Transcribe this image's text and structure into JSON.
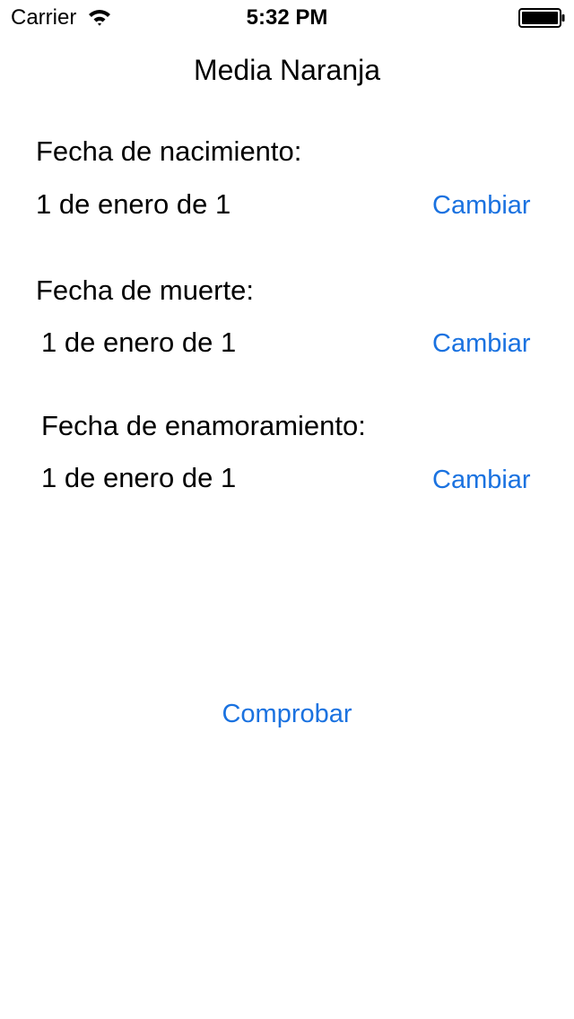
{
  "status_bar": {
    "carrier": "Carrier",
    "time": "5:32 PM",
    "wifi_icon": "wifi-icon",
    "battery_icon": "battery-full-icon"
  },
  "nav": {
    "title": "Media Naranja"
  },
  "sections": [
    {
      "label": "Fecha de nacimiento:",
      "value": "1 de enero de 1",
      "button": "Cambiar"
    },
    {
      "label": "Fecha de muerte:",
      "value": "1 de enero de 1",
      "button": "Cambiar"
    },
    {
      "label": "Fecha de enamoramiento:",
      "value": "1 de enero de 1",
      "button": "Cambiar"
    }
  ],
  "actions": {
    "check_label": "Comprobar"
  },
  "colors": {
    "accent": "#1a72e0",
    "text": "#000000",
    "background": "#ffffff"
  }
}
